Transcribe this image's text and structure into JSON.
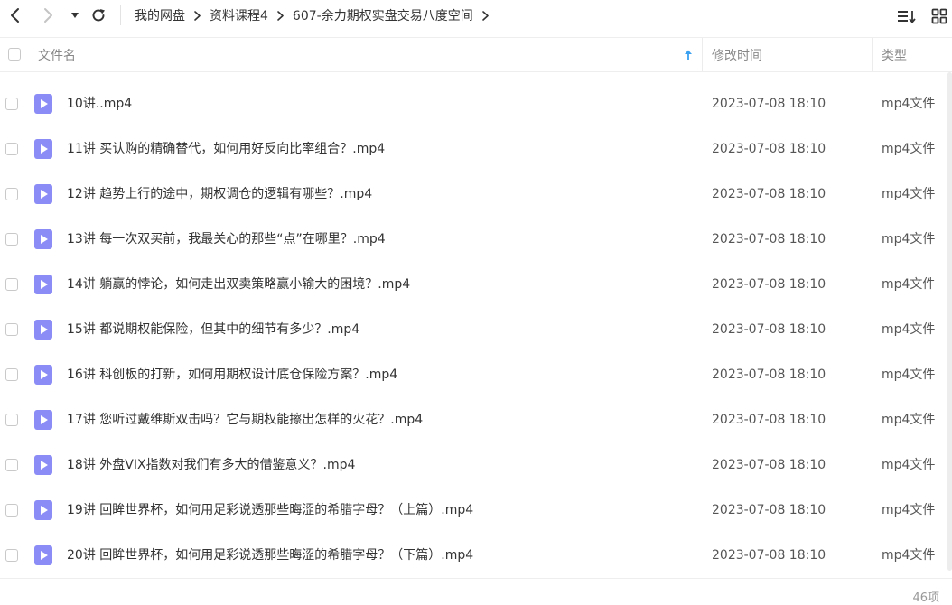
{
  "nav": {
    "back_icon": "chevron-left-icon",
    "forward_icon": "chevron-right-icon",
    "dropdown_icon": "caret-down-icon",
    "refresh_icon": "refresh-icon"
  },
  "breadcrumb": {
    "items": [
      "我的网盘",
      "资料课程4",
      "607-余力期权实盘交易八度空间"
    ]
  },
  "view_controls": {
    "sort_icon": "sort-list-icon",
    "grid_icon": "grid-view-icon"
  },
  "table": {
    "columns": {
      "name": "文件名",
      "modified": "修改时间",
      "type": "类型"
    },
    "sort_indicator_icon": "arrow-up-icon",
    "rows": [
      {
        "name": "10讲..mp4",
        "modified": "2023-07-08 18:10",
        "type": "mp4文件"
      },
      {
        "name": "11讲 买认购的精确替代，如何用好反向比率组合？.mp4",
        "modified": "2023-07-08 18:10",
        "type": "mp4文件"
      },
      {
        "name": "12讲 趋势上行的途中，期权调仓的逻辑有哪些？.mp4",
        "modified": "2023-07-08 18:10",
        "type": "mp4文件"
      },
      {
        "name": "13讲  每一次双买前，我最关心的那些“点”在哪里？.mp4",
        "modified": "2023-07-08 18:10",
        "type": "mp4文件"
      },
      {
        "name": "14讲 躺赢的悖论，如何走出双卖策略赢小输大的困境？.mp4",
        "modified": "2023-07-08 18:10",
        "type": "mp4文件"
      },
      {
        "name": "15讲 都说期权能保险，但其中的细节有多少？.mp4",
        "modified": "2023-07-08 18:10",
        "type": "mp4文件"
      },
      {
        "name": "16讲  科创板的打新，如何用期权设计底仓保险方案？.mp4",
        "modified": "2023-07-08 18:10",
        "type": "mp4文件"
      },
      {
        "name": "17讲 您听过戴维斯双击吗？它与期权能擦出怎样的火花？.mp4",
        "modified": "2023-07-08 18:10",
        "type": "mp4文件"
      },
      {
        "name": "18讲 外盘VIX指数对我们有多大的借鉴意义？.mp4",
        "modified": "2023-07-08 18:10",
        "type": "mp4文件"
      },
      {
        "name": "19讲 回眸世界杯，如何用足彩说透那些晦涩的希腊字母？（上篇）.mp4",
        "modified": "2023-07-08 18:10",
        "type": "mp4文件"
      },
      {
        "name": "20讲 回眸世界杯，如何用足彩说透那些晦涩的希腊字母？（下篇）.mp4",
        "modified": "2023-07-08 18:10",
        "type": "mp4文件"
      }
    ]
  },
  "footer": {
    "count": "46项"
  },
  "colors": {
    "video_icon": "#8b8cf5",
    "sort_arrow": "#3aa0f0"
  }
}
